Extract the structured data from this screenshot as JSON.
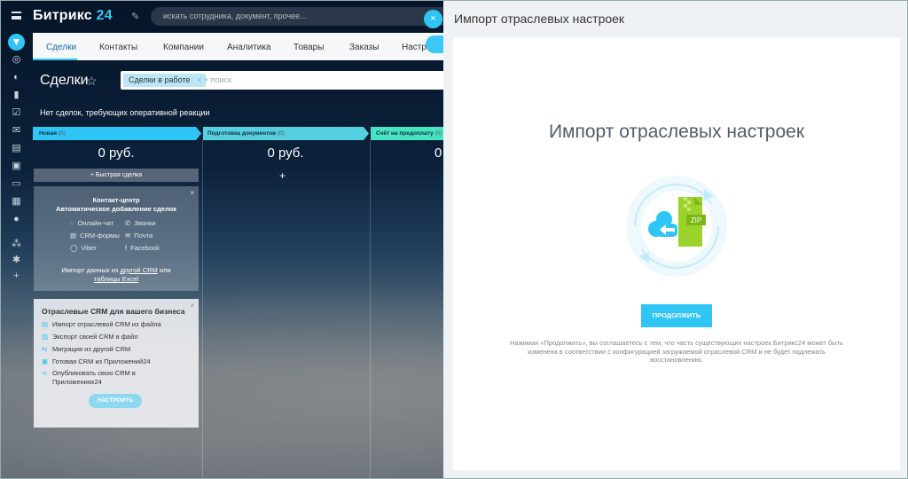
{
  "app": {
    "logo_main": "Битрикс",
    "logo_num": "24"
  },
  "search": {
    "placeholder": "искать сотрудника, документ, прочее..."
  },
  "tabs": [
    "Сделки",
    "Контакты",
    "Компании",
    "Аналитика",
    "Товары",
    "Заказы",
    "Настр"
  ],
  "page": {
    "title": "Сделки"
  },
  "filter": {
    "chip": "Сделки в работе",
    "chip_remove": "×",
    "placeholder": "+ поиск"
  },
  "notice": "Нет сделок, требующих оперативной реакции",
  "stages": [
    {
      "name": "Новая",
      "count": "(0)",
      "color": "#2fc6f6",
      "sum": "0 руб."
    },
    {
      "name": "Подготовка документов",
      "count": "(0)",
      "color": "#55d0e0",
      "sum": "0 руб."
    },
    {
      "name": "Счёт на предоплату",
      "count": "(0)",
      "color": "#47e4c2",
      "sum": "0"
    }
  ],
  "quick_deal": "+ Быстрая сделка",
  "add_plus": "+",
  "contact_center": {
    "title_line1": "Контакт-центр",
    "title_line2": "Автоматическое добавление сделок",
    "channels": [
      "Онлайн-чат",
      "Звонки",
      "CRM-формы",
      "Почта",
      "Viber",
      "Facebook"
    ],
    "import_text": "Импорт данных из",
    "import_link1": "другой CRM",
    "import_or": "или",
    "import_link2": "таблицы Excel",
    "close": "×"
  },
  "industry_crm": {
    "title": "Отраслевые CRM для вашего бизнеса",
    "items": [
      "Импорт отраслевой CRM из файла",
      "Экспорт своей CRM в файл",
      "Миграция из другой CRM",
      "Готовая CRM из Приложений24",
      "Опубликовать свою CRM в",
      "Приложениях24"
    ],
    "button": "НАСТРОИТЬ",
    "close": "×"
  },
  "panel": {
    "title": "Импорт отраслевых настроек",
    "close": "×",
    "heading": "Импорт отраслевых настроек",
    "zip_label": "ZIP",
    "button": "ПРОДОЛЖИТЬ",
    "note": "Нажимая «Продолжить», вы соглашаетесь с тем, что часть существующих настроек Битрикс24 может быть изменена в соответствии с конфигурацией загружаемой отраслевой CRM и не будет подлежать восстановлению."
  },
  "colors": {
    "accent": "#2fc6f6",
    "zip_green": "#9bd22b"
  }
}
